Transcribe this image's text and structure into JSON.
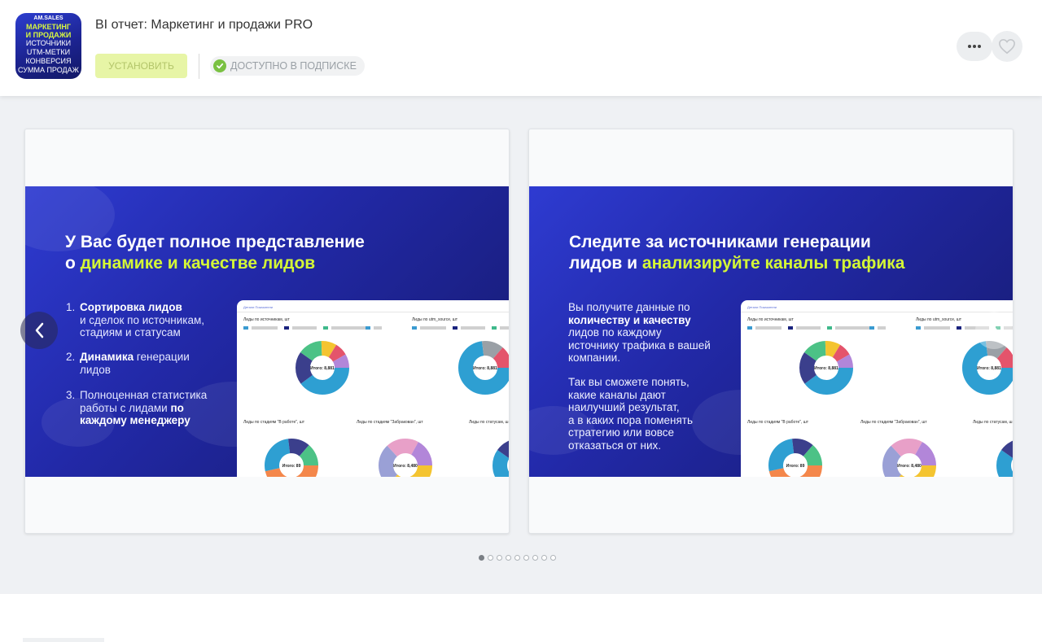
{
  "app": {
    "icon_lines": {
      "brand": "AM.SALES",
      "title": [
        "МАРКЕТИНГ",
        "И ПРОДАЖИ"
      ],
      "features": [
        "ИСТОЧНИКИ",
        "UTM-МЕТКИ",
        "КОНВЕРСИЯ",
        "СУММА ПРОДАЖ"
      ]
    },
    "title": "BI отчет: Маркетинг и продажи PRO",
    "install_label": "УСТАНОВИТЬ",
    "subscription_label": "ДОСТУПНО В ПОДПИСКЕ"
  },
  "colors": {
    "accent_lime": "#d4f736",
    "banner_blue": "#2229a8",
    "check_green": "#7ac142"
  },
  "slides": [
    {
      "heading_line1": "У Вас будет полное представление",
      "heading_prefix": "о ",
      "heading_highlight": "динамике и качестве лидов",
      "points": [
        {
          "num": "1.",
          "bold": "Сортировка лидов",
          "line2": "и сделок по источникам,",
          "line3": "стадиям и статусам"
        },
        {
          "num": "2.",
          "bold": "Динамика",
          "rest": " генерации",
          "line2": "лидов"
        },
        {
          "num": "3.",
          "line1": "Полноценная статистика",
          "line2_pre": "работы с лидами ",
          "line2_bold": "по",
          "line3_bold": "каждому менеджеру"
        }
      ],
      "screenshot": {
        "tabs": "Детали   Показатели",
        "chart1_title": "Лиды по источникам, шт",
        "chart2_title": "Лиды по utm_source, шт",
        "chart3_title": "Лиды по стадиям \"В работе\", шт",
        "chart4_title": "Лиды по стадиям \"Забракован\", шт",
        "chart5_title": "Лиды по статусам, ш",
        "donut1_total": "Итого: 8,881",
        "donut2_total": "Итого: 8,881",
        "donut3_total": "Итого: 89",
        "donut4_total": "Итого: 8,480"
      }
    },
    {
      "heading_line1": "Следите за источниками генерации",
      "heading_prefix": "лидов и ",
      "heading_highlight": "анализируйте каналы трафика",
      "para1": {
        "l1": "Вы получите данные по",
        "l2_bold": "количеству и качеству",
        "l3": "лидов по каждому",
        "l4": "источнику трафика в вашей",
        "l5": "компании."
      },
      "para2": [
        "Так вы сможете понять,",
        "какие каналы дают",
        "наилучший результат,",
        "а в каких пора поменять",
        "стратегию или вовсе",
        "отказаться от них."
      ],
      "screenshot": {
        "tabs": "Детали   Показатели",
        "chart1_title": "Лиды по источникам, шт",
        "chart2_title": "Лиды по utm_source, шт",
        "chart3_title": "Лиды по стадиям \"В работе\", шт",
        "chart4_title": "Лиды по стадиям \"Забракован\", шт",
        "chart5_title": "Лиды по статусам, ш",
        "donut1_total": "Итого: 8,881",
        "donut2_total": "Итого: 8,881",
        "donut3_total": "Итого: 89",
        "donut4_total": "Итого: 8,480"
      }
    }
  ],
  "pagination": {
    "total": 9,
    "active": 1
  }
}
